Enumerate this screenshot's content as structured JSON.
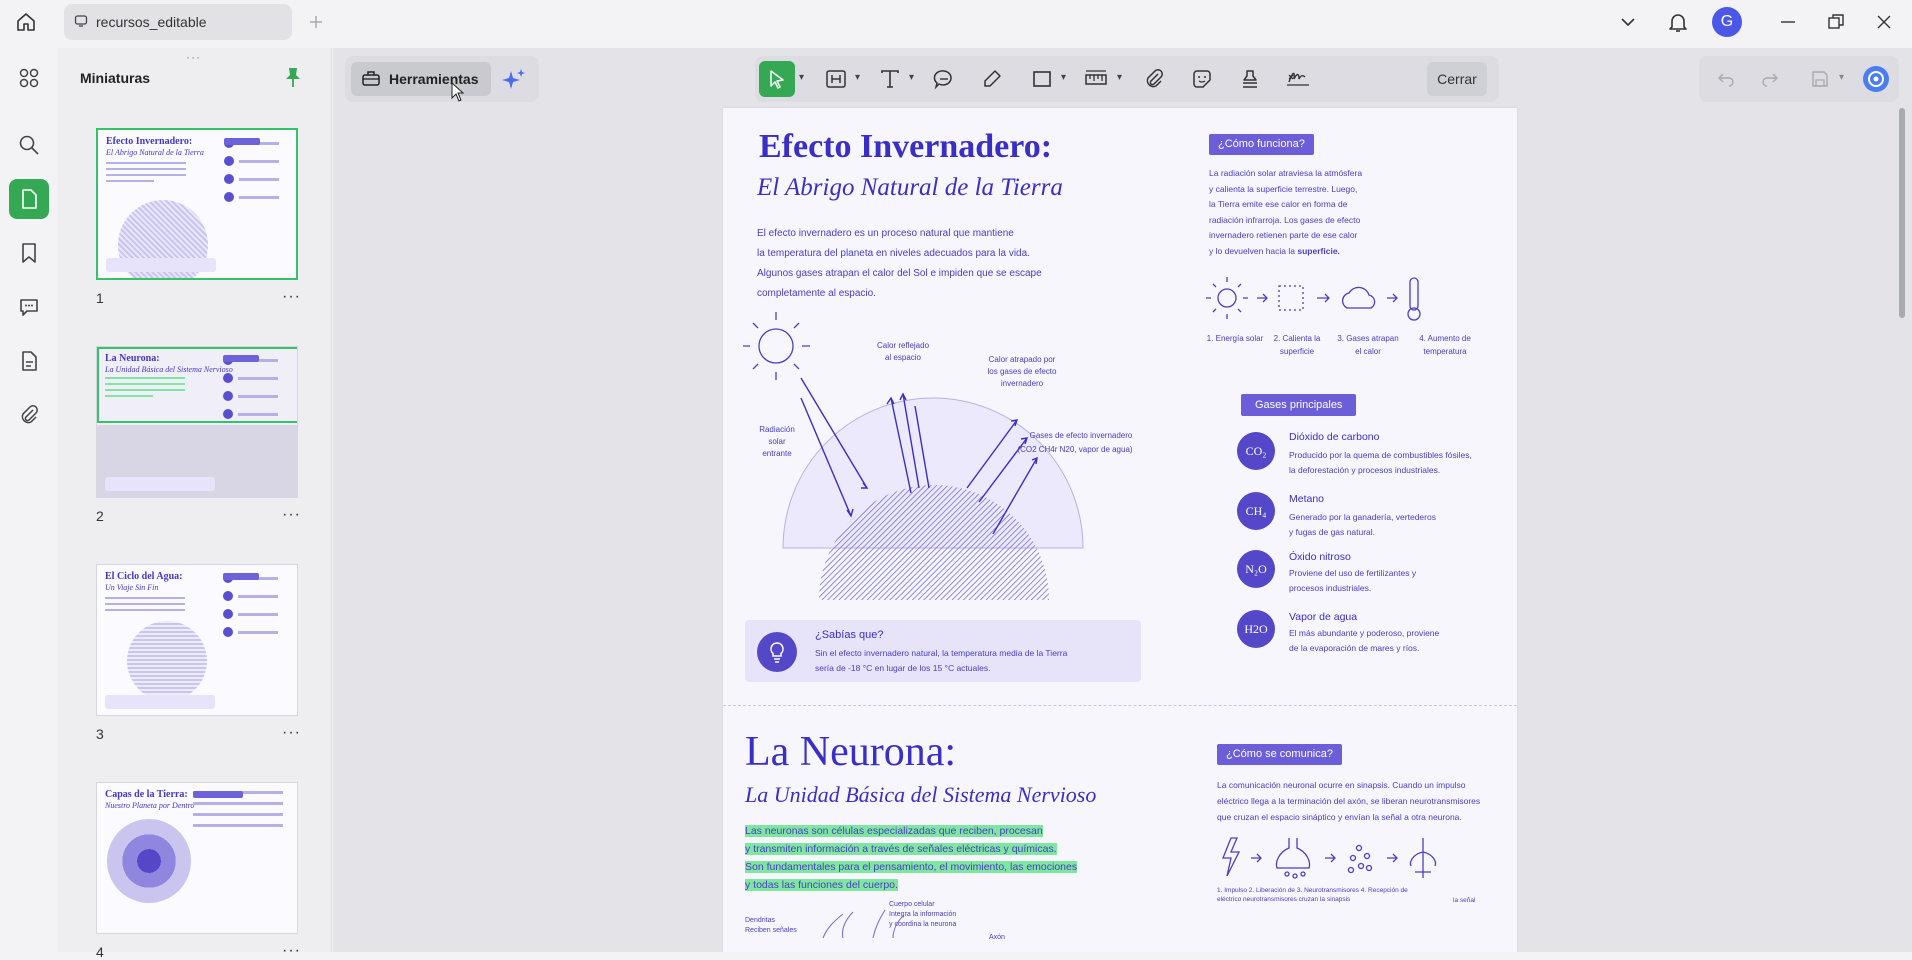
{
  "window": {
    "tab_title": "recursos_editable",
    "avatar_letter": "G"
  },
  "sidebar": {
    "title": "Miniaturas",
    "pages": [
      {
        "number": "1",
        "title": "Efecto Invernadero:",
        "subtitle": "El Abrigo Natural de la Tierra",
        "more": "···"
      },
      {
        "number": "2",
        "title": "La Neurona:",
        "subtitle": "La Unidad Básica del Sistema Nervioso",
        "more": "···"
      },
      {
        "number": "3",
        "title": "El Ciclo del Agua:",
        "subtitle": "Un Viaje Sin Fin",
        "more": "···"
      },
      {
        "number": "4",
        "title": "Capas de la Tierra:",
        "subtitle": "Nuestro Planeta por Dentro",
        "more": "···"
      }
    ]
  },
  "toolbar": {
    "tools_label": "Herramientas",
    "close_label": "Cerrar"
  },
  "page1": {
    "title": "Efecto Invernadero:",
    "subtitle": "El Abrigo Natural de la Tierra",
    "intro": [
      "El efecto invernadero es un proceso natural que mantiene",
      "la temperatura del planeta en niveles adecuados para la vida.",
      "Algunos gases atrapan el calor del Sol e impiden que se escape",
      "completamente al espacio."
    ],
    "how_chip": "¿Cómo funciona?",
    "how_text": [
      "La radiación solar atraviesa la atmósfera",
      "y calienta la superficie terrestre. Luego,",
      "la Tierra emite ese calor en forma de",
      "radiación infrarroja. Los gases de efecto",
      "invernadero retienen parte de ese calor",
      "y lo devuelven hacia la"
    ],
    "how_text_bold": "superficie.",
    "steps": [
      "1. Energía solar",
      "2. Calienta la superficie",
      "3. Gases atrapan el calor",
      "4. Aumento de temperatura"
    ],
    "diagram": {
      "reflected": "Calor reflejado al espacio",
      "trapped": "Calor atrapado por los gases de efecto invernadero",
      "incoming": "Radiación solar entrante",
      "gases": "Gases de efecto invernadero",
      "gases_list": "(CO2 CH4r N20, vapor de agua)"
    },
    "gases_chip": "Gases principales",
    "gases": [
      {
        "symbol": "CO₂",
        "name": "Dióxido de carbono",
        "desc1": "Producido por la quema de combustibles fósiles,",
        "desc2": "la deforestación y procesos industriales."
      },
      {
        "symbol": "CH₄",
        "name": "Metano",
        "desc1": "Generado por la ganadería, vertederos",
        "desc2": "y fugas de gas natural."
      },
      {
        "symbol": "N₂O",
        "name": "Óxido nitroso",
        "desc1": "Proviene del uso de fertilizantes y",
        "desc2": "procesos industriales."
      },
      {
        "symbol": "H2O",
        "name": "Vapor de agua",
        "desc1": "El más abundante y poderoso, proviene",
        "desc2": "de la evaporación de mares y ríos."
      }
    ],
    "fact_title": "¿Sabías que?",
    "fact_line1": "Sin el efecto invernadero natural, la temperatura media de la Tierra",
    "fact_line2": "sería de -18 °C en lugar de los 15 °C actuales."
  },
  "page2": {
    "title": "La Neurona:",
    "subtitle": "La Unidad Básica del Sistema Nervioso",
    "intro": [
      "Las neuronas son células especializadas que reciben, procesan",
      "y transmiten información a través de señales eléctricas y químicas.",
      "Son fundamentales para el pensamiento, el movimiento, las emociones",
      "y todas las funciones del cuerpo."
    ],
    "comm_chip": "¿Cómo se comunica?",
    "comm_text": [
      "La comunicación neuronal ocurre en sinapsis. Cuando un impulso",
      "eléctrico llega a la terminación del axón, se liberan neurotransmisores",
      "que cruzan el espacio sináptico y envían la señal a otra neurona."
    ],
    "steps_line": "1. Impulso      2. Liberación de   3. Neurotransmisores  4. Recepción de",
    "steps_line2": "eléctrico neurotransmisores cruzan la sinapsis",
    "steps_end": "la señal",
    "labels": {
      "body": "Cuerpo celular",
      "body2": "Integra la información",
      "body3": "y coordina la neurona",
      "dendrites": "Dendritas",
      "dendrites2": "Reciben señales",
      "axon": "Axón"
    }
  }
}
